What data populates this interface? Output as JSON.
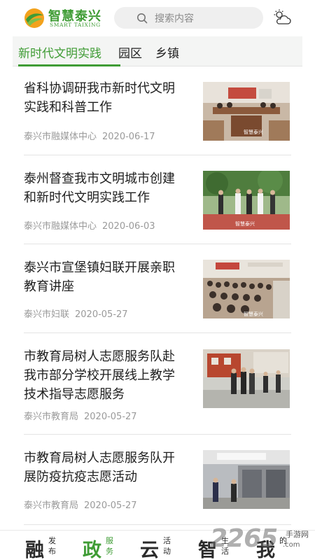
{
  "header": {
    "logo_cn": "智慧泰兴",
    "logo_en": "SMART TAIXING",
    "search_placeholder": "搜索内容",
    "weather_icon": "weather-cloud-sun-icon"
  },
  "tabs": [
    {
      "label": "新时代文明实践",
      "active": true
    },
    {
      "label": "园区",
      "active": false
    },
    {
      "label": "乡镇",
      "active": false
    }
  ],
  "news": [
    {
      "title": "省科协调研我市新时代文明实践和科普工作",
      "source": "泰兴市融媒体中心",
      "date": "2020-06-17",
      "thumb_watermark": "智慧泰兴"
    },
    {
      "title": "泰州督查我市文明城市创建和新时代文明实践工作",
      "source": "泰兴市融媒体中心",
      "date": "2020-06-03",
      "thumb_watermark": "智慧泰兴"
    },
    {
      "title": "泰兴市宣堡镇妇联开展亲职教育讲座",
      "source": "泰兴市妇联",
      "date": "2020-05-27",
      "thumb_watermark": "智慧泰兴"
    },
    {
      "title": "市教育局树人志愿服务队赴我市部分学校开展线上教学技术指导志愿服务",
      "source": "泰兴市教育局",
      "date": "2020-05-27",
      "thumb_watermark": ""
    },
    {
      "title": "市教育局树人志愿服务队开展防疫抗疫志愿活动",
      "source": "泰兴市教育局",
      "date": "2020-05-27",
      "thumb_watermark": ""
    }
  ],
  "bottom_nav": [
    {
      "big": "融",
      "small": "发布",
      "active": false
    },
    {
      "big": "政",
      "small": "服务",
      "active": true
    },
    {
      "big": "云",
      "small": "活动",
      "active": false
    },
    {
      "big": "智",
      "small": "生活",
      "active": false
    },
    {
      "big": "我",
      "small": "的",
      "active": false
    }
  ],
  "watermark": {
    "number": "2265",
    "cn": "手游网",
    "url": ".com"
  },
  "colors": {
    "accent": "#3f9c35",
    "tab_bg": "#f4f5f4",
    "meta": "#9a9a9a"
  }
}
